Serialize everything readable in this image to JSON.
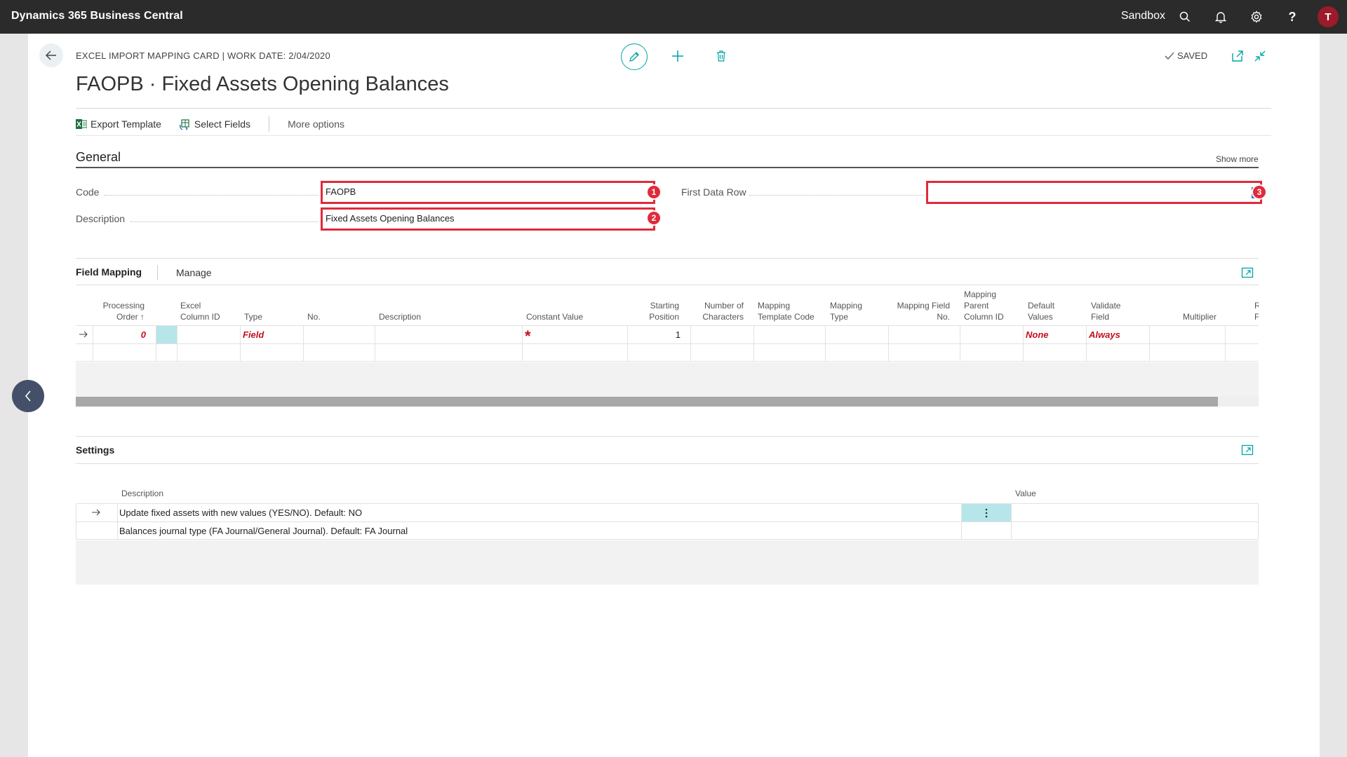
{
  "appbar": {
    "title": "Dynamics 365 Business Central",
    "environment": "Sandbox",
    "avatar_letter": "T",
    "avatar_color": "#9b1b2a"
  },
  "header": {
    "breadcrumb": "EXCEL IMPORT MAPPING CARD | WORK DATE: 2/04/2020",
    "title": "FAOPB · Fixed Assets Opening Balances",
    "saved_label": "SAVED"
  },
  "actions": {
    "export_template": "Export Template",
    "select_fields": "Select Fields",
    "more_options": "More options"
  },
  "general": {
    "title": "General",
    "show_more": "Show more",
    "code_label": "Code",
    "code_value": "FAOPB",
    "description_label": "Description",
    "description_value": "Fixed Assets Opening Balances",
    "first_data_row_label": "First Data Row",
    "first_data_row_value": "",
    "badges": [
      "1",
      "2",
      "3"
    ]
  },
  "field_mapping": {
    "title": "Field Mapping",
    "manage": "Manage",
    "columns": {
      "processing_order_1": "Processing",
      "processing_order_2": "Order ↑",
      "excel_col_1": "Excel",
      "excel_col_2": "Column ID",
      "type": "Type",
      "no": "No.",
      "description": "Description",
      "constant_value": "Constant Value",
      "starting_pos_1": "Starting",
      "starting_pos_2": "Position",
      "num_chars_1": "Number of",
      "num_chars_2": "Characters",
      "mapping_tpl_1": "Mapping",
      "mapping_tpl_2": "Template Code",
      "mapping_type_1": "Mapping",
      "mapping_type_2": "Type",
      "mapping_field_1": "Mapping Field",
      "mapping_field_2": "No.",
      "mapping_parent_1": "Mapping",
      "mapping_parent_2": "Parent",
      "mapping_parent_3": "Column ID",
      "default_values_1": "Default",
      "default_values_2": "Values",
      "validate_field_1": "Validate",
      "validate_field_2": "Field",
      "multiplier": "Multiplier",
      "truncated_1": "R",
      "truncated_2": "F"
    },
    "row": {
      "processing_order": "0",
      "type": "Field",
      "constant_value": "*",
      "starting_position": "1",
      "default_values": "None",
      "validate_field": "Always"
    }
  },
  "settings": {
    "title": "Settings",
    "col_description": "Description",
    "col_value": "Value",
    "rows": [
      {
        "description": "Update fixed assets with new values (YES/NO).  Default: NO",
        "value": ""
      },
      {
        "description": "Balances journal type (FA Journal/General Journal). Default: FA Journal",
        "value": ""
      }
    ]
  },
  "colors": {
    "accent_teal": "#00a4a6",
    "highlight_red": "#e02b3a",
    "selected_cell": "#b6e6ea"
  }
}
